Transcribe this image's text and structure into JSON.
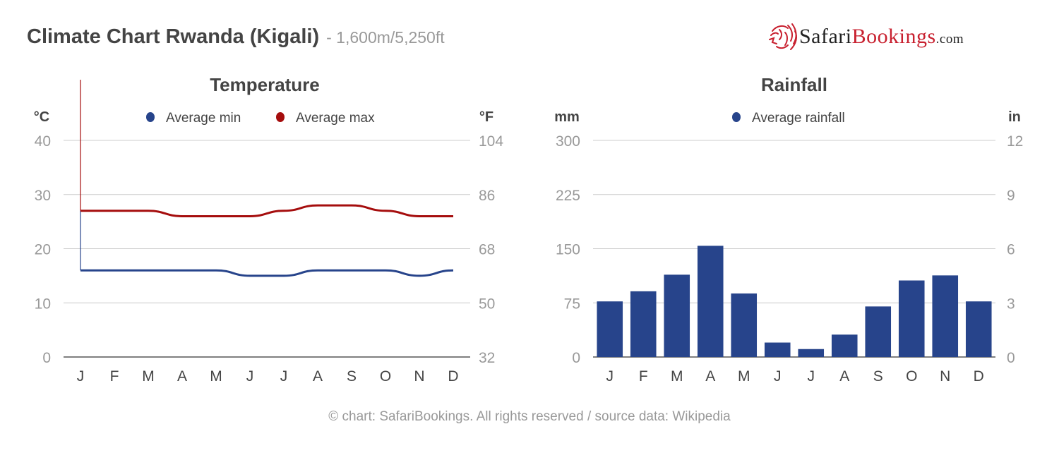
{
  "header": {
    "title": "Climate Chart Rwanda (Kigali)",
    "subtitle": "- 1,600m/5,250ft"
  },
  "logo": {
    "part1": "Safari",
    "part2": "Bookings",
    "part3": ".com",
    "icon": "lion-head-icon",
    "color_dark": "#222222",
    "color_red": "#c8202f"
  },
  "footer": {
    "text": "© chart: SafariBookings. All rights reserved / source data: Wikipedia"
  },
  "chart_data": [
    {
      "type": "line",
      "title": "Temperature",
      "categories": [
        "J",
        "F",
        "M",
        "A",
        "M",
        "J",
        "J",
        "A",
        "S",
        "O",
        "N",
        "D"
      ],
      "ylabel_left": "°C",
      "ylabel_right": "°F",
      "ylim": [
        0,
        40
      ],
      "yticks_left": [
        "0",
        "10",
        "20",
        "30",
        "40"
      ],
      "yticks_right": [
        "32",
        "50",
        "68",
        "86",
        "104"
      ],
      "grid": true,
      "legend": "top-center",
      "series": [
        {
          "name": "Average min",
          "color": "#27448b",
          "values": [
            16,
            16,
            16,
            16,
            16,
            15,
            15,
            16,
            16,
            16,
            15,
            16
          ]
        },
        {
          "name": "Average max",
          "color": "#a50d0d",
          "values": [
            27,
            27,
            27,
            26,
            26,
            26,
            27,
            28,
            28,
            27,
            26,
            26
          ]
        }
      ]
    },
    {
      "type": "bar",
      "title": "Rainfall",
      "categories": [
        "J",
        "F",
        "M",
        "A",
        "M",
        "J",
        "J",
        "A",
        "S",
        "O",
        "N",
        "D"
      ],
      "ylabel_left": "mm",
      "ylabel_right": "in",
      "ylim": [
        0,
        300
      ],
      "yticks_left": [
        "0",
        "75",
        "150",
        "225",
        "300"
      ],
      "yticks_right": [
        "0",
        "3",
        "6",
        "9",
        "12"
      ],
      "grid": true,
      "legend": "top-center",
      "series": [
        {
          "name": "Average rainfall",
          "color": "#27448b",
          "values": [
            77,
            91,
            114,
            154,
            88,
            20,
            11,
            31,
            70,
            106,
            113,
            77
          ]
        }
      ]
    }
  ]
}
